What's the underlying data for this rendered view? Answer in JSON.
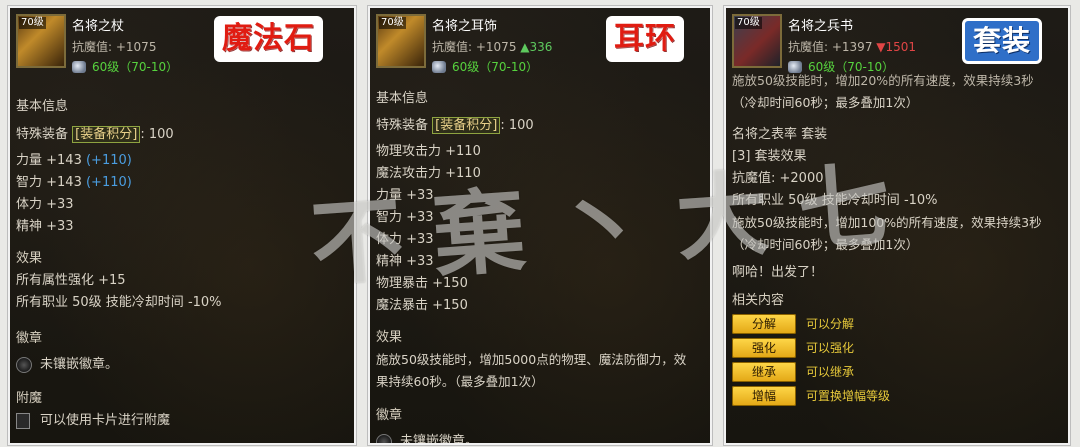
{
  "panel1": {
    "level_tag": "70级",
    "name": "名将之杖",
    "resist": "抗魔值: +1075",
    "level": "60级（70-10）",
    "badge": "魔法石",
    "basic_title": "基本信息",
    "special_prefix": "特殊装备",
    "special_tag": "[装备积分]",
    "special_value": ": 100",
    "stats": [
      {
        "text": "力量 +143",
        "extra": "(+110)"
      },
      {
        "text": "智力 +143",
        "extra": "(+110)"
      },
      {
        "text": "体力 +33",
        "extra": ""
      },
      {
        "text": "精神 +33",
        "extra": ""
      }
    ],
    "effect_title": "效果",
    "effects": [
      "所有属性强化 +15",
      "所有职业 50级 技能冷却时间 -10%"
    ],
    "emblem_title": "徽章",
    "emblem_text": "未镶嵌徽章。",
    "enchant_title": "附魔",
    "enchant_text": "可以使用卡片进行附魔"
  },
  "panel2": {
    "level_tag": "70级",
    "name": "名将之耳饰",
    "resist": "抗魔值: +1075",
    "resist_change": "▲336",
    "level": "60级（70-10）",
    "badge": "耳环",
    "basic_title": "基本信息",
    "special_prefix": "特殊装备",
    "special_tag": "[装备积分]",
    "special_value": ": 100",
    "stats": [
      "物理攻击力 +110",
      "魔法攻击力 +110",
      "力量 +33",
      "智力 +33",
      "体力 +33",
      "精神 +33",
      "物理暴击 +150",
      "魔法暴击 +150"
    ],
    "effect_title": "效果",
    "effect_lines": [
      "施放50级技能时，增加5000点的物理、魔法防御力，效",
      "果持续60秒。（最多叠加1次）"
    ],
    "emblem_title": "徽章",
    "emblem_text": "未镶嵌徽章。"
  },
  "panel3": {
    "level_tag": "70级",
    "name": "名将之兵书",
    "resist": "抗魔值: +1397",
    "resist_change": "▼1501",
    "level": "60级（70-10）",
    "badge": "套装",
    "cut_line": "施放50级技能时，增加20%的所有速度，效果持续3秒",
    "cut_line2": "（冷却时间60秒；最多叠加1次）",
    "set_name": "名将之表率 套装",
    "set_effect": "[3] 套装效果",
    "set_lines": [
      "抗魔值: +2000",
      "所有职业 50级 技能冷却时间 -10%",
      "施放50级技能时，增加100%的所有速度，效果持续3秒",
      "（冷却时间60秒；最多叠加1次）"
    ],
    "shout": "啊哈！出发了！",
    "related_title": "相关内容",
    "actions": [
      {
        "btn": "分解",
        "desc": "可以分解"
      },
      {
        "btn": "强化",
        "desc": "可以强化"
      },
      {
        "btn": "继承",
        "desc": "可以继承"
      },
      {
        "btn": "增幅",
        "desc": "可置换增幅等级"
      }
    ]
  },
  "watermark": "不棄丶大七",
  "colors": {
    "accent_gold": "#e2a614",
    "green": "#56d23e",
    "blue_stat": "#4a9de0",
    "badge_red": "#e01c12",
    "badge_blue": "#2f6fc8"
  }
}
